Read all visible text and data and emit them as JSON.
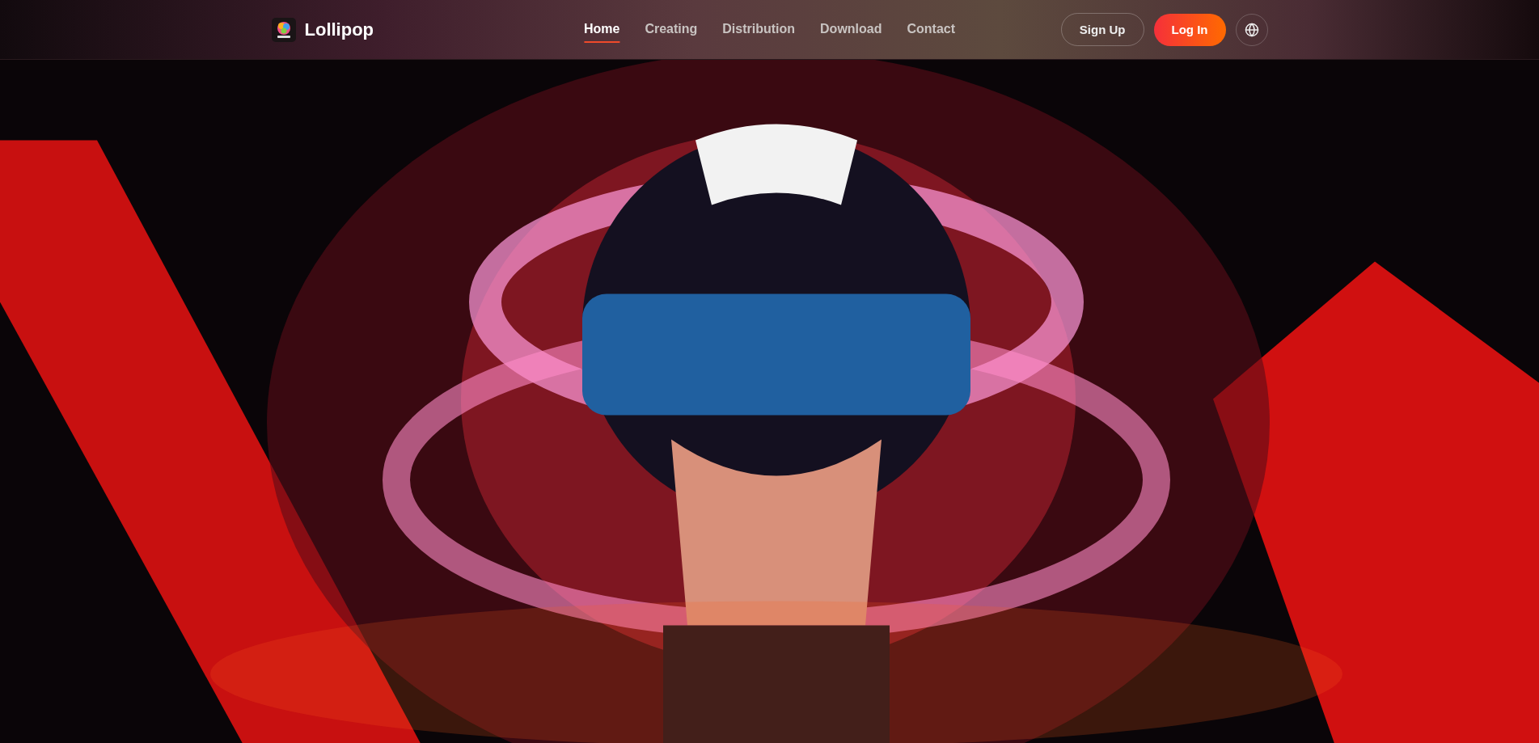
{
  "header": {
    "brand": "Lollipop",
    "nav": [
      {
        "label": "Home",
        "selected": true
      },
      {
        "label": "Creating",
        "selected": false
      },
      {
        "label": "Distribution",
        "selected": false
      },
      {
        "label": "Download",
        "selected": false
      },
      {
        "label": "Contact",
        "selected": false
      }
    ],
    "sign_up": "Sign Up",
    "log_in": "Log In"
  }
}
